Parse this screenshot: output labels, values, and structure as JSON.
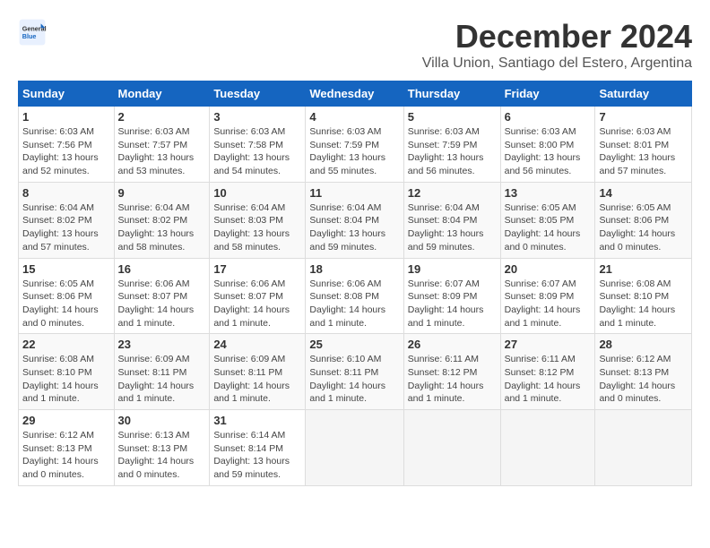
{
  "logo": {
    "general": "General",
    "blue": "Blue"
  },
  "title": "December 2024",
  "subtitle": "Villa Union, Santiago del Estero, Argentina",
  "days_of_week": [
    "Sunday",
    "Monday",
    "Tuesday",
    "Wednesday",
    "Thursday",
    "Friday",
    "Saturday"
  ],
  "weeks": [
    [
      {
        "day": "1",
        "info": "Sunrise: 6:03 AM\nSunset: 7:56 PM\nDaylight: 13 hours\nand 52 minutes."
      },
      {
        "day": "2",
        "info": "Sunrise: 6:03 AM\nSunset: 7:57 PM\nDaylight: 13 hours\nand 53 minutes."
      },
      {
        "day": "3",
        "info": "Sunrise: 6:03 AM\nSunset: 7:58 PM\nDaylight: 13 hours\nand 54 minutes."
      },
      {
        "day": "4",
        "info": "Sunrise: 6:03 AM\nSunset: 7:59 PM\nDaylight: 13 hours\nand 55 minutes."
      },
      {
        "day": "5",
        "info": "Sunrise: 6:03 AM\nSunset: 7:59 PM\nDaylight: 13 hours\nand 56 minutes."
      },
      {
        "day": "6",
        "info": "Sunrise: 6:03 AM\nSunset: 8:00 PM\nDaylight: 13 hours\nand 56 minutes."
      },
      {
        "day": "7",
        "info": "Sunrise: 6:03 AM\nSunset: 8:01 PM\nDaylight: 13 hours\nand 57 minutes."
      }
    ],
    [
      {
        "day": "8",
        "info": "Sunrise: 6:04 AM\nSunset: 8:02 PM\nDaylight: 13 hours\nand 57 minutes."
      },
      {
        "day": "9",
        "info": "Sunrise: 6:04 AM\nSunset: 8:02 PM\nDaylight: 13 hours\nand 58 minutes."
      },
      {
        "day": "10",
        "info": "Sunrise: 6:04 AM\nSunset: 8:03 PM\nDaylight: 13 hours\nand 58 minutes."
      },
      {
        "day": "11",
        "info": "Sunrise: 6:04 AM\nSunset: 8:04 PM\nDaylight: 13 hours\nand 59 minutes."
      },
      {
        "day": "12",
        "info": "Sunrise: 6:04 AM\nSunset: 8:04 PM\nDaylight: 13 hours\nand 59 minutes."
      },
      {
        "day": "13",
        "info": "Sunrise: 6:05 AM\nSunset: 8:05 PM\nDaylight: 14 hours\nand 0 minutes."
      },
      {
        "day": "14",
        "info": "Sunrise: 6:05 AM\nSunset: 8:06 PM\nDaylight: 14 hours\nand 0 minutes."
      }
    ],
    [
      {
        "day": "15",
        "info": "Sunrise: 6:05 AM\nSunset: 8:06 PM\nDaylight: 14 hours\nand 0 minutes."
      },
      {
        "day": "16",
        "info": "Sunrise: 6:06 AM\nSunset: 8:07 PM\nDaylight: 14 hours\nand 1 minute."
      },
      {
        "day": "17",
        "info": "Sunrise: 6:06 AM\nSunset: 8:07 PM\nDaylight: 14 hours\nand 1 minute."
      },
      {
        "day": "18",
        "info": "Sunrise: 6:06 AM\nSunset: 8:08 PM\nDaylight: 14 hours\nand 1 minute."
      },
      {
        "day": "19",
        "info": "Sunrise: 6:07 AM\nSunset: 8:09 PM\nDaylight: 14 hours\nand 1 minute."
      },
      {
        "day": "20",
        "info": "Sunrise: 6:07 AM\nSunset: 8:09 PM\nDaylight: 14 hours\nand 1 minute."
      },
      {
        "day": "21",
        "info": "Sunrise: 6:08 AM\nSunset: 8:10 PM\nDaylight: 14 hours\nand 1 minute."
      }
    ],
    [
      {
        "day": "22",
        "info": "Sunrise: 6:08 AM\nSunset: 8:10 PM\nDaylight: 14 hours\nand 1 minute."
      },
      {
        "day": "23",
        "info": "Sunrise: 6:09 AM\nSunset: 8:11 PM\nDaylight: 14 hours\nand 1 minute."
      },
      {
        "day": "24",
        "info": "Sunrise: 6:09 AM\nSunset: 8:11 PM\nDaylight: 14 hours\nand 1 minute."
      },
      {
        "day": "25",
        "info": "Sunrise: 6:10 AM\nSunset: 8:11 PM\nDaylight: 14 hours\nand 1 minute."
      },
      {
        "day": "26",
        "info": "Sunrise: 6:11 AM\nSunset: 8:12 PM\nDaylight: 14 hours\nand 1 minute."
      },
      {
        "day": "27",
        "info": "Sunrise: 6:11 AM\nSunset: 8:12 PM\nDaylight: 14 hours\nand 1 minute."
      },
      {
        "day": "28",
        "info": "Sunrise: 6:12 AM\nSunset: 8:13 PM\nDaylight: 14 hours\nand 0 minutes."
      }
    ],
    [
      {
        "day": "29",
        "info": "Sunrise: 6:12 AM\nSunset: 8:13 PM\nDaylight: 14 hours\nand 0 minutes."
      },
      {
        "day": "30",
        "info": "Sunrise: 6:13 AM\nSunset: 8:13 PM\nDaylight: 14 hours\nand 0 minutes."
      },
      {
        "day": "31",
        "info": "Sunrise: 6:14 AM\nSunset: 8:14 PM\nDaylight: 13 hours\nand 59 minutes."
      },
      {
        "day": "",
        "info": ""
      },
      {
        "day": "",
        "info": ""
      },
      {
        "day": "",
        "info": ""
      },
      {
        "day": "",
        "info": ""
      }
    ]
  ]
}
